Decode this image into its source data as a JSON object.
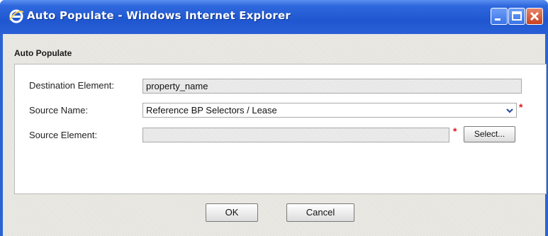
{
  "window": {
    "title": "Auto Populate - Windows Internet Explorer"
  },
  "section": {
    "title": "Auto Populate"
  },
  "form": {
    "destination_label": "Destination Element:",
    "destination_value": "property_name",
    "source_name_label": "Source Name:",
    "source_name_value": "Reference BP Selectors / Lease",
    "source_element_label": "Source Element:",
    "source_element_value": "",
    "required_mark": "*",
    "select_button": "Select..."
  },
  "footer": {
    "ok": "OK",
    "cancel": "Cancel"
  },
  "colors": {
    "title_bar": "#2a63d3",
    "required": "#e01a1a",
    "dialog_bg": "#eae9e3"
  }
}
